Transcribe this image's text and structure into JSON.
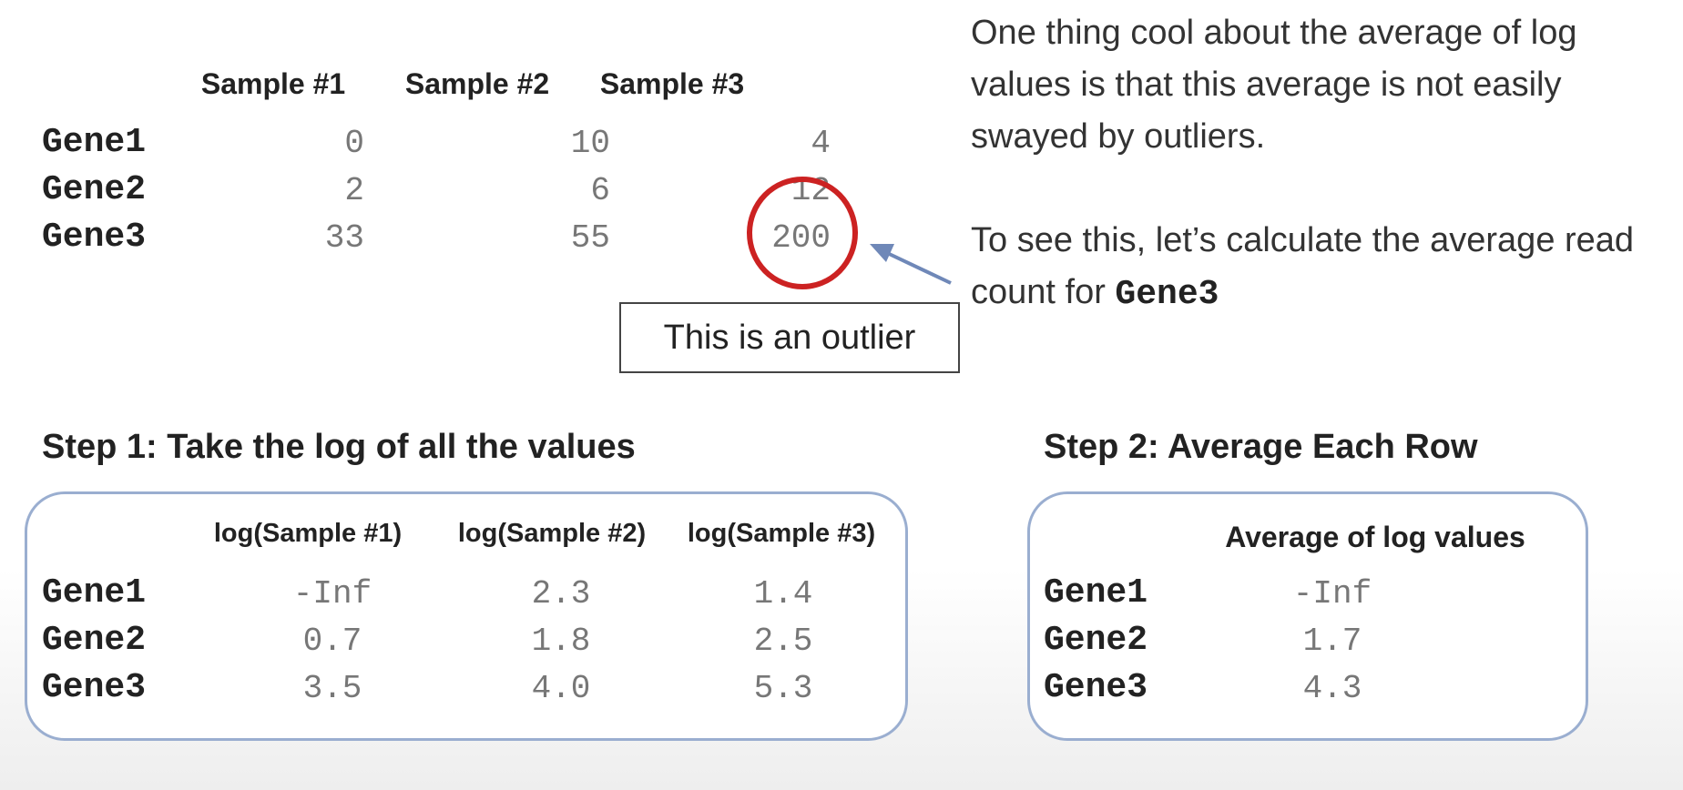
{
  "top_table": {
    "headers": [
      "Sample #1",
      "Sample #2",
      "Sample #3"
    ],
    "rows": [
      {
        "gene": "Gene1",
        "values": [
          "0",
          "10",
          "4"
        ]
      },
      {
        "gene": "Gene2",
        "values": [
          "2",
          "6",
          "12"
        ]
      },
      {
        "gene": "Gene3",
        "values": [
          "33",
          "55",
          "200"
        ]
      }
    ]
  },
  "outlier_label": "This is an outlier",
  "explanation": {
    "paragraph1": "One thing cool about the average of log values is that this average is not easily swayed by outliers.",
    "paragraph2_text": "To see this, let’s calculate the average read count for ",
    "paragraph2_gene": "Gene3"
  },
  "step1": {
    "title": "Step 1: Take the log of all the values",
    "headers": [
      "log(Sample #1)",
      "log(Sample #2)",
      "log(Sample #3)"
    ],
    "rows": [
      {
        "gene": "Gene1",
        "values": [
          "-Inf",
          "2.3",
          "1.4"
        ]
      },
      {
        "gene": "Gene2",
        "values": [
          "0.7",
          "1.8",
          "2.5"
        ]
      },
      {
        "gene": "Gene3",
        "values": [
          "3.5",
          "4.0",
          "5.3"
        ]
      }
    ]
  },
  "step2": {
    "title": "Step 2: Average Each Row",
    "header": "Average of log values",
    "rows": [
      {
        "gene": "Gene1",
        "value": "-Inf"
      },
      {
        "gene": "Gene2",
        "value": "1.7"
      },
      {
        "gene": "Gene3",
        "value": "4.3"
      }
    ]
  },
  "colors": {
    "outlier_circle": "#cc2222",
    "arrow": "#6f88b8",
    "box_border": "#9aaed0"
  }
}
